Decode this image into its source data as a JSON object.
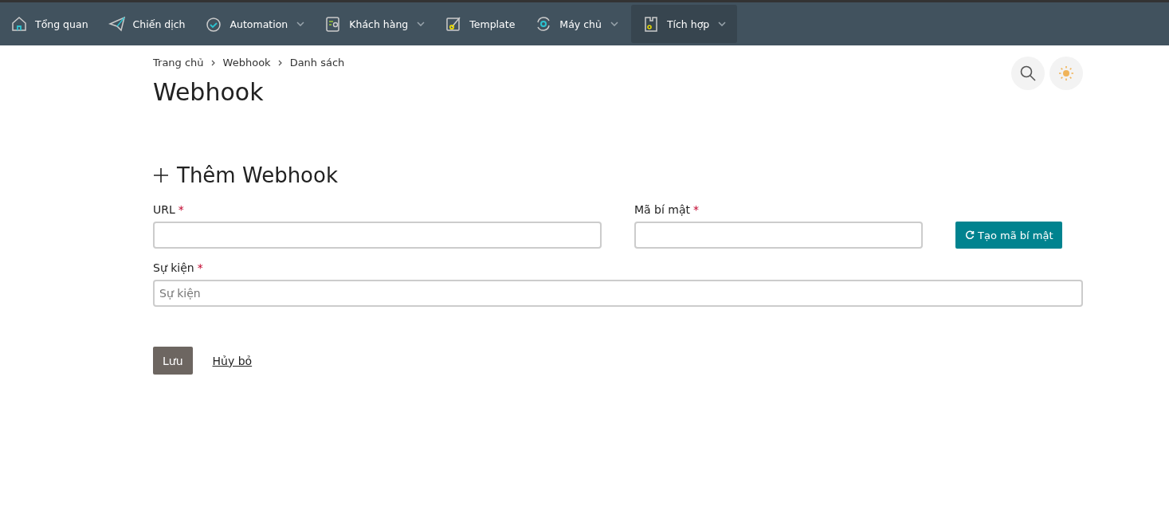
{
  "nav": {
    "items": [
      {
        "label": "Tổng quan",
        "dropdown": false,
        "selected": false
      },
      {
        "label": "Chiến dịch",
        "dropdown": false,
        "selected": false
      },
      {
        "label": "Automation",
        "dropdown": true,
        "selected": false
      },
      {
        "label": "Khách hàng",
        "dropdown": true,
        "selected": false
      },
      {
        "label": "Template",
        "dropdown": false,
        "selected": false
      },
      {
        "label": "Máy chủ",
        "dropdown": true,
        "selected": false
      },
      {
        "label": "Tích hợp",
        "dropdown": true,
        "selected": true
      }
    ]
  },
  "breadcrumb": [
    "Trang chủ",
    "Webhook",
    "Danh sách"
  ],
  "title": "Webhook",
  "form": {
    "heading": "Thêm Webhook",
    "url": {
      "label": "URL",
      "required_mark": "*"
    },
    "secret": {
      "label": "Mã bí mật",
      "required_mark": "*"
    },
    "generate_button": "Tạo mã bí mật",
    "events": {
      "label": "Sự kiện",
      "required_mark": "*",
      "placeholder": "Sự kiện"
    },
    "save_button": "Lưu",
    "cancel_link": "Hủy bỏ"
  }
}
